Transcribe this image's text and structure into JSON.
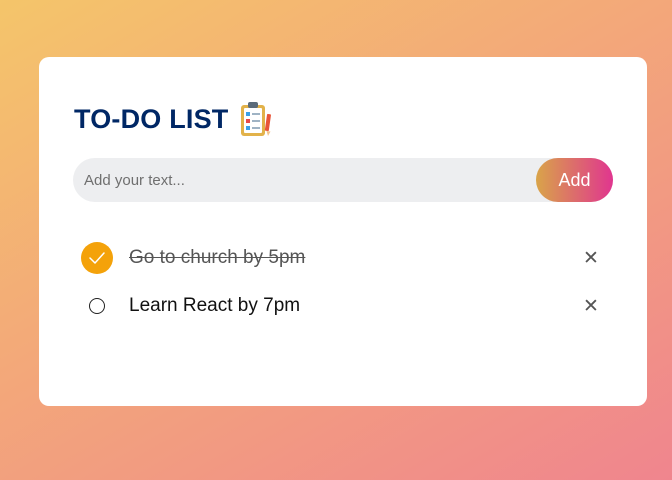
{
  "app": {
    "title": "TO-DO LIST",
    "title_icon": "clipboard-checklist-icon"
  },
  "input": {
    "placeholder": "Add your text...",
    "value": ""
  },
  "add_button": {
    "label": "Add"
  },
  "tasks": [
    {
      "text": "Go to church by 5pm",
      "completed": true,
      "remove_icon": "close-icon",
      "remove_glyph": "✕"
    },
    {
      "text": "Learn React by 7pm",
      "completed": false,
      "remove_icon": "close-icon",
      "remove_glyph": "✕"
    }
  ],
  "colors": {
    "title": "#002765",
    "check_done": "#f4a20a",
    "add_gradient_start": "#d9a449",
    "add_gradient_end": "#e0358f",
    "background_start": "#f4c56a",
    "background_end": "#f0858e"
  }
}
